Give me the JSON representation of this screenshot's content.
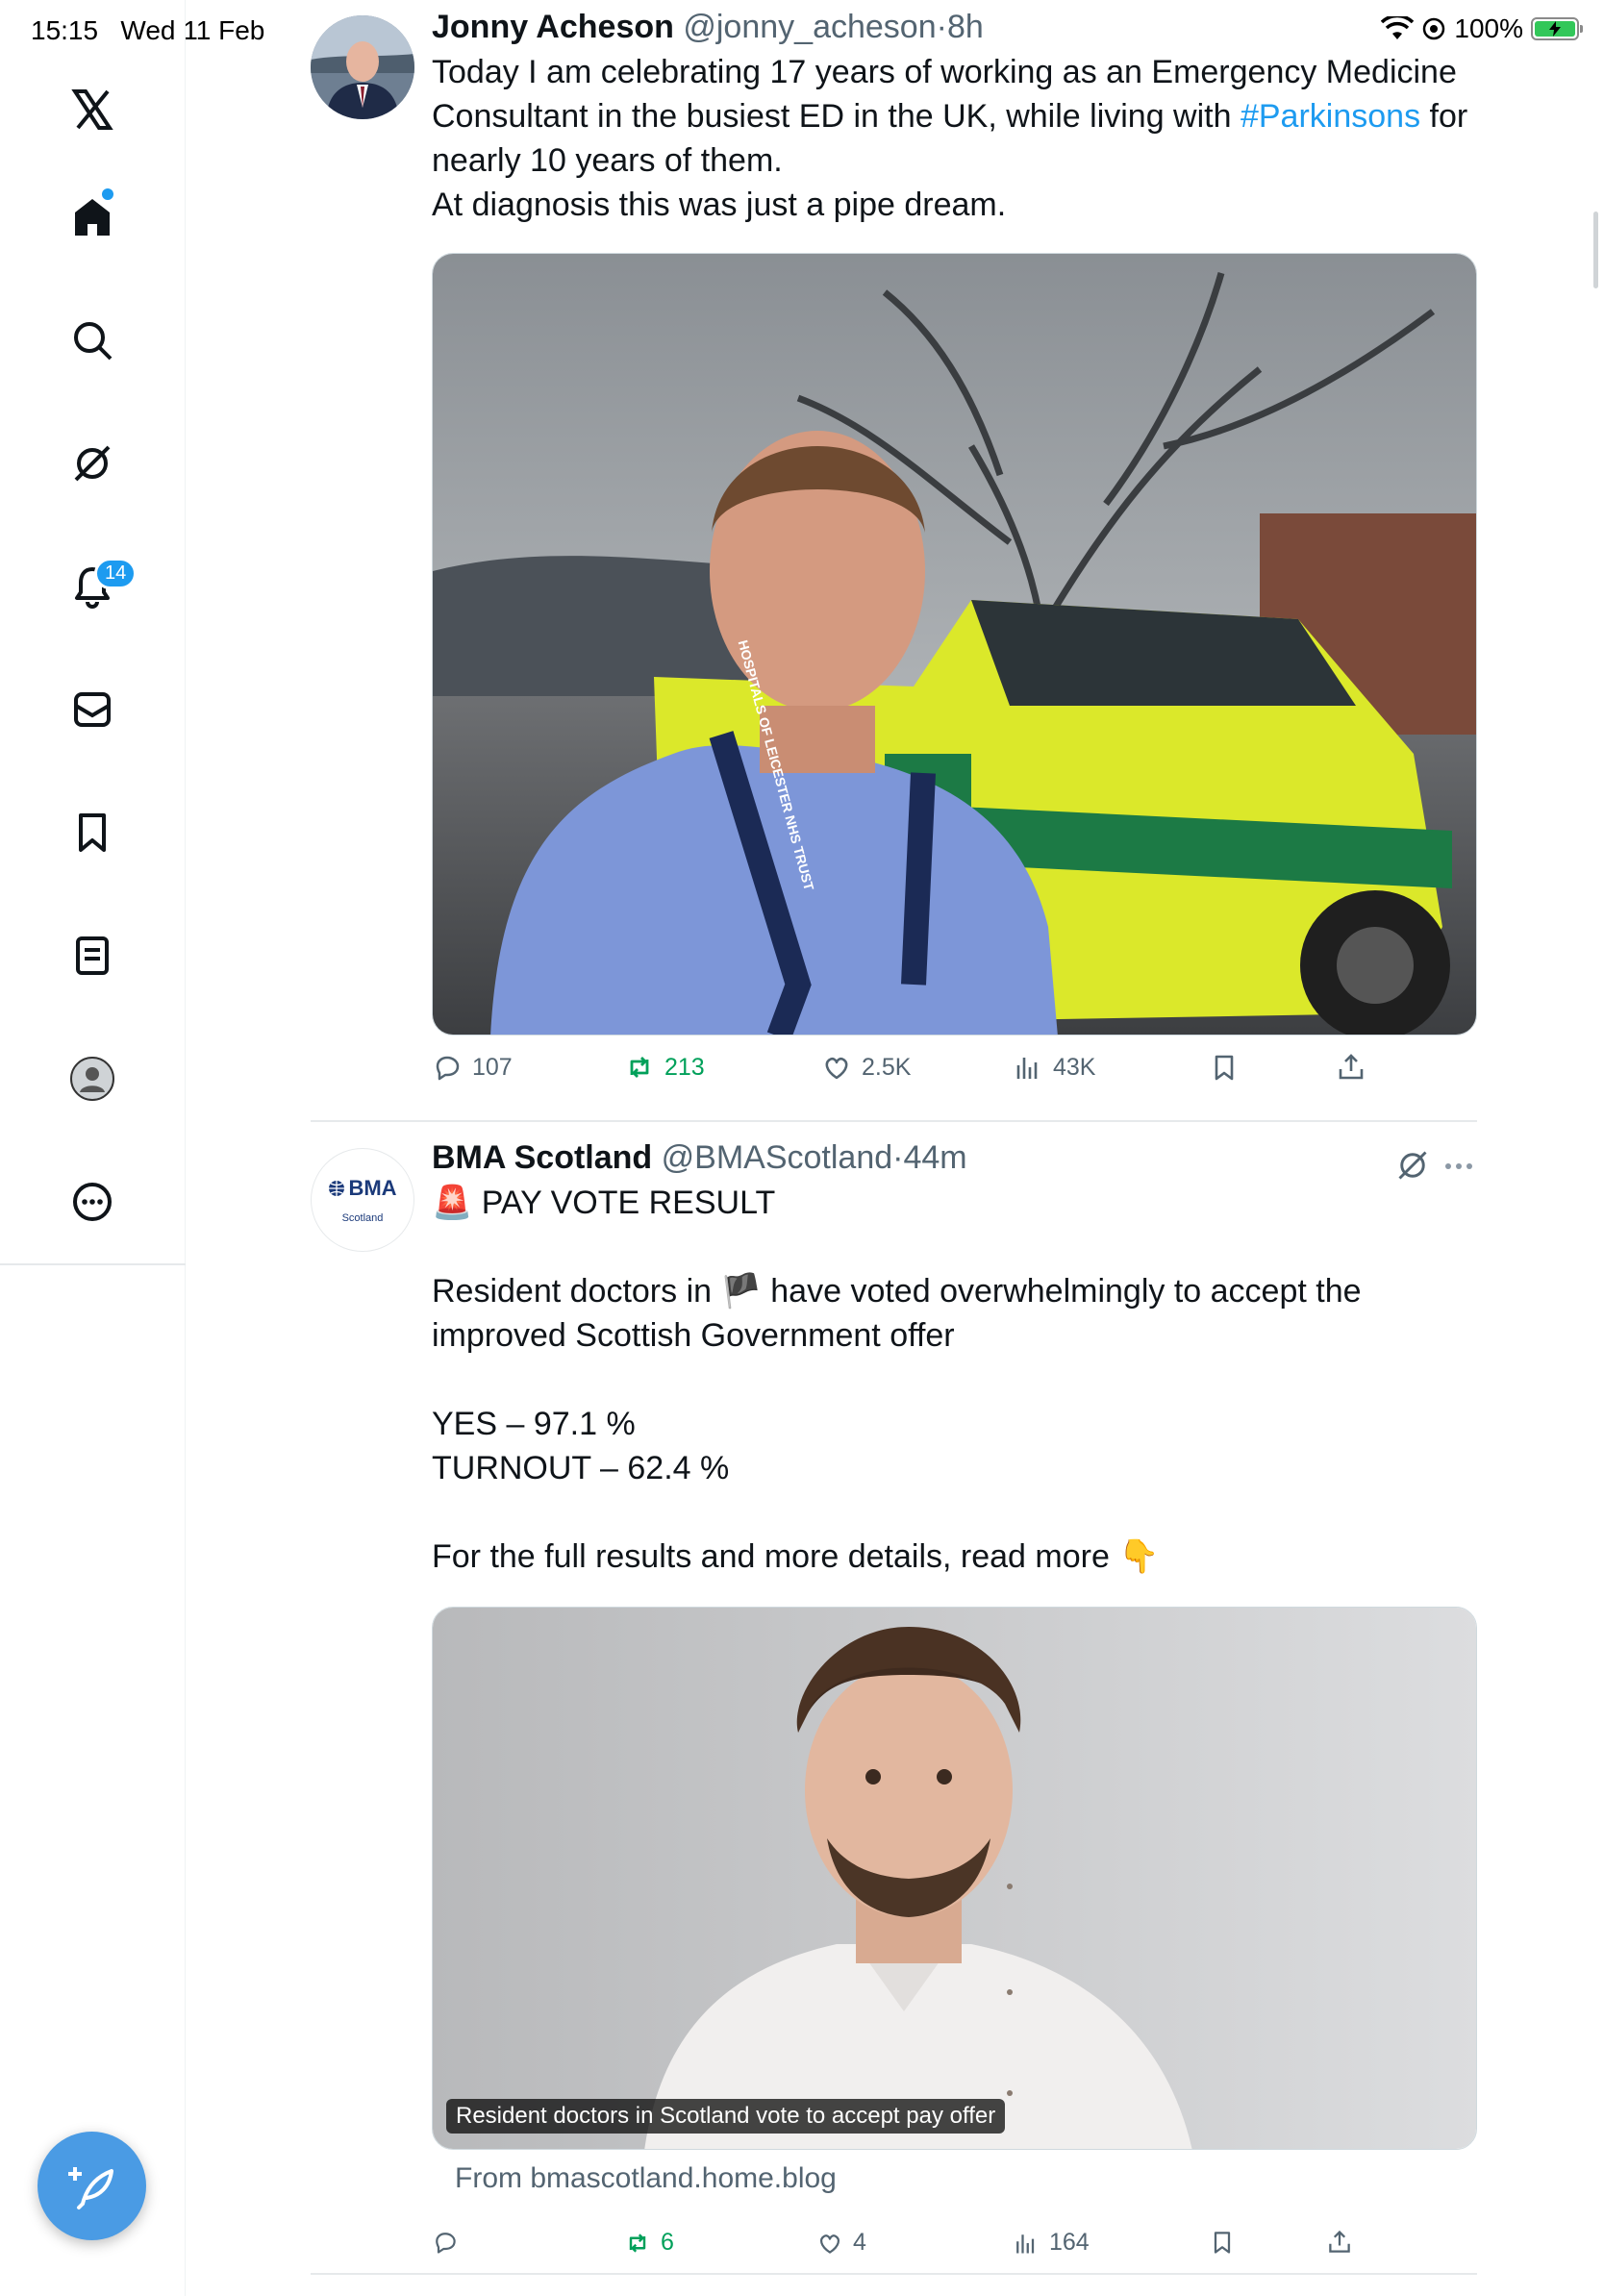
{
  "status_bar": {
    "time": "15:15",
    "date": "Wed 11 Feb",
    "battery": "100%",
    "battery_fraction": 1.0
  },
  "sidebar": {
    "items": [
      {
        "icon": "x-logo-icon",
        "label": "X"
      },
      {
        "icon": "home-icon",
        "label": "Home"
      },
      {
        "icon": "search-icon",
        "label": "Search"
      },
      {
        "icon": "grok-icon",
        "label": "Grok"
      },
      {
        "icon": "bell-icon",
        "label": "Notifications",
        "badge": "14"
      },
      {
        "icon": "mail-icon",
        "label": "Messages"
      },
      {
        "icon": "bookmark-icon",
        "label": "Bookmarks"
      },
      {
        "icon": "lists-icon",
        "label": "Lists"
      },
      {
        "icon": "profile-icon",
        "label": "Profile"
      },
      {
        "icon": "more-icon",
        "label": "More"
      }
    ],
    "notification_badge": "14",
    "compose_icon": "compose-icon"
  },
  "tweets": [
    {
      "name": "Jonny Acheson",
      "handle": "@jonny_acheson",
      "time": "8h",
      "text_before": "Today I am celebrating 17 years of working as an Emergency Medicine Consultant in the busiest ED in the UK, while living with ",
      "hashtag": "#Parkinsons",
      "text_after": " for nearly 10 years of them.\nAt diagnosis this was just a pipe dream.",
      "media_alt": "Selfie of a man in a blue shirt with a lanyard in front of a yellow and green ambulance",
      "lanyard_text": "HOSPITALS OF LEICESTER NHS TRUST",
      "stats": {
        "replies": "107",
        "reposts": "213",
        "likes": "2.5K",
        "views": "43K"
      }
    },
    {
      "name": "BMA Scotland",
      "handle": "@BMAScotland",
      "time": "44m",
      "avatar_text": "BMA",
      "avatar_subtext": "Scotland",
      "text": "🚨 PAY VOTE RESULT\n\nResident doctors in 🏴 have voted overwhelmingly to accept the improved Scottish Government offer\n\nYES – 97.1 %\nTURNOUT – 62.4 %\n\nFor the full results and more details, read more 👇",
      "card_caption": "Resident doctors in Scotland vote to accept pay offer",
      "card_source": "From bmascotland.home.blog",
      "stats": {
        "replies": "",
        "reposts": "6",
        "likes": "4",
        "views": "164"
      }
    }
  ],
  "colors": {
    "accent": "#1d9bf0",
    "repost_active": "#00a05a",
    "muted": "#536471"
  }
}
